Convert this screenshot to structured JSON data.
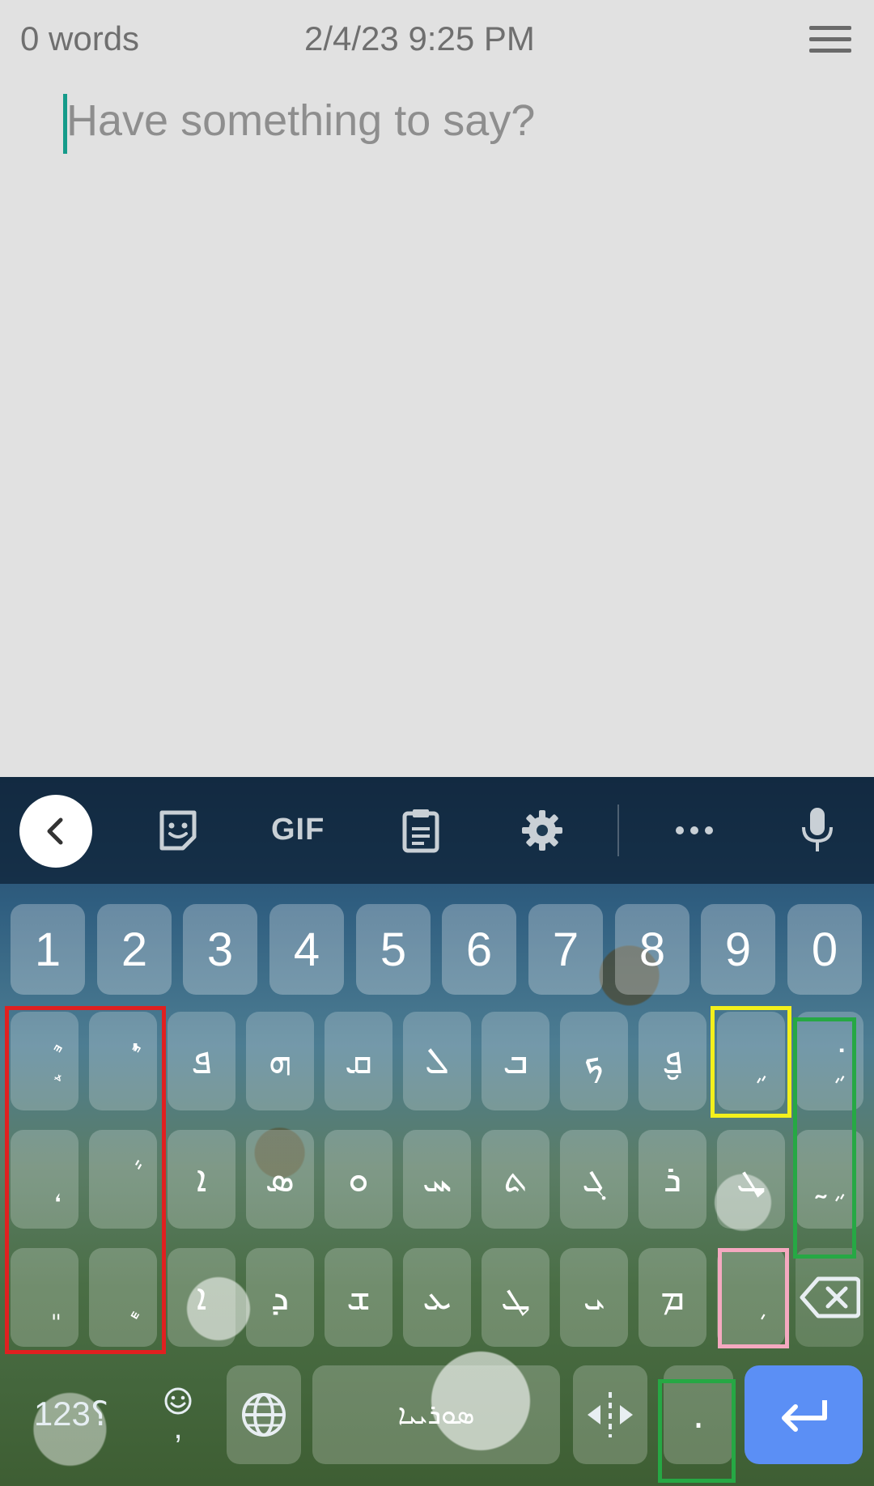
{
  "header": {
    "word_count": "0 words",
    "timestamp": "2/4/23 9:25 PM"
  },
  "editor": {
    "placeholder": "Have something to say?"
  },
  "toolbar": {
    "gif_label": "GIF",
    "items": [
      "back-icon",
      "sticker-icon",
      "gif",
      "clipboard-icon",
      "gear-icon",
      "more-icon",
      "mic-icon"
    ]
  },
  "keyboard": {
    "numbers": [
      "1",
      "2",
      "3",
      "4",
      "5",
      "6",
      "7",
      "8",
      "9",
      "0"
    ],
    "row1": [
      "ܱܶ",
      "ܳܶ",
      "ܦ",
      "ܗ",
      "ܩ",
      "ܠ",
      "ܒ",
      "ܟ",
      "ܦ̮",
      "ܹ",
      "ܹ݁"
    ],
    "row2": [
      "ܴ",
      "ܵ",
      "ܐ",
      "ܣ",
      "ܘ",
      "ܚ",
      "ܬ",
      "ܓ",
      "ܪ",
      "ܜ",
      "ܹ̰"
    ],
    "row3": [
      "ܸ",
      "ܷ",
      "ܐ",
      "ܕ",
      "ܫ",
      "ܥ",
      "ܛ",
      "ܝ",
      "ܡ",
      "ܼ"
    ],
    "bottom": {
      "symbols_label": "؟123",
      "emoji_comma": ",",
      "space_label": "ܣܘܪܝܝܐ",
      "period": "."
    }
  },
  "colors": {
    "accent_caret": "#159b8a",
    "enter_key": "#5b8ff5",
    "highlight_red": "#e02020",
    "highlight_yellow": "#f3f01c",
    "highlight_green": "#26a844",
    "highlight_pink": "#f5a9c0"
  }
}
